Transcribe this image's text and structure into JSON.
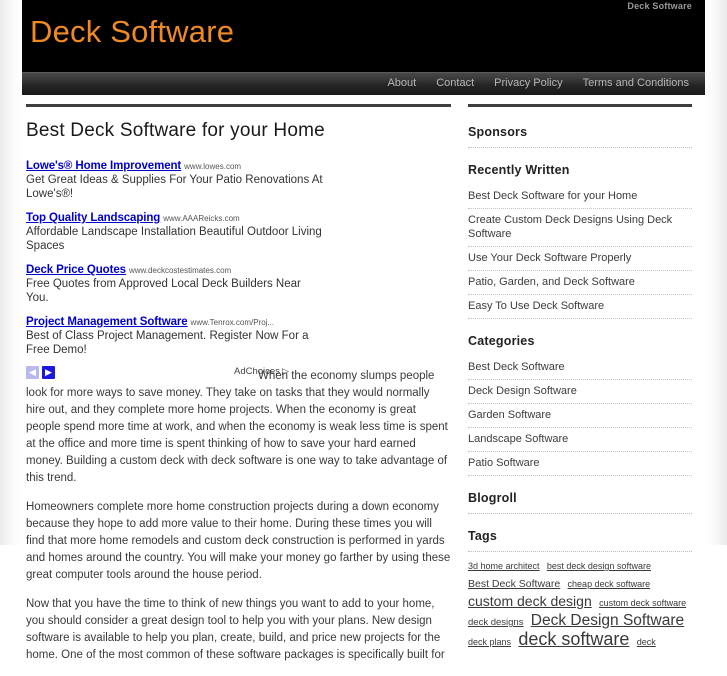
{
  "header": {
    "tagline": "Deck Software",
    "title": "Deck Software"
  },
  "nav": {
    "items": [
      {
        "label": "About"
      },
      {
        "label": "Contact"
      },
      {
        "label": "Privacy Policy"
      },
      {
        "label": "Terms and Conditions"
      }
    ]
  },
  "post": {
    "title": "Best Deck Software for your Home",
    "paragraphs": [
      "When the economy slumps people look for more ways to save money. They take on tasks that they would normally hire out, and they complete more home projects. When the economy is great people spend more time at work, and when the economy is weak less time is spent at the office and more time is spent thinking of how to save your hard earned money. Building a custom deck with deck software is one way to take advantage of this trend.",
      "Homeowners complete more home construction projects during a down economy because they hope to add more value to their home. During these times you will find that more home remodels and custom deck construction is performed in yards and homes around the country. You will make your money go farther by using these great computer tools around the house period.",
      "Now that you have the time to think of new things you want to add to your home, you should consider a great design tool to help you with your plans. New design software is available to help you plan, create, build, and price new projects for the home. One of the most common of these software packages is specifically built for"
    ]
  },
  "ads": {
    "units": [
      {
        "title": "Lowe's® Home Improvement",
        "url": "www.lowes.com",
        "desc": "Get Great Ideas & Supplies For Your Patio Renovations At Lowe's®!"
      },
      {
        "title": "Top Quality Landscaping",
        "url": "www.AAAReicks.com",
        "desc": "Affordable Landscape Installation Beautiful Outdoor Living Spaces"
      },
      {
        "title": "Deck Price Quotes",
        "url": "www.deckcostestimates.com",
        "desc": "Free Quotes from Approved Local Deck Builders Near You."
      },
      {
        "title": "Project Management Software",
        "url": "www.Tenrox.com/Proj...",
        "desc": "Best of Class Project Management. Register Now For a Free Demo!"
      }
    ],
    "prev_arrow": "◀",
    "next_arrow": "▶",
    "adchoices_label": "AdChoices",
    "adchoices_marker": "▷"
  },
  "sidebar": {
    "widgets": [
      {
        "title": "Sponsors",
        "items": []
      },
      {
        "title": "Recently Written",
        "items": [
          "Best Deck Software for your Home",
          "Create Custom Deck Designs Using Deck Software",
          "Use Your Deck Software Properly",
          "Patio, Garden, and Deck Software",
          "Easy To Use Deck Software"
        ]
      },
      {
        "title": "Categories",
        "items": [
          "Best Deck Software",
          "Deck Design Software",
          "Garden Software",
          "Landscape Software",
          "Patio Software"
        ]
      },
      {
        "title": "Blogroll",
        "items": []
      }
    ],
    "tags_title": "Tags",
    "tags": [
      {
        "label": "3d home architect",
        "size": 9
      },
      {
        "label": "best deck design software",
        "size": 9
      },
      {
        "label": "Best Deck Software",
        "size": 10.5
      },
      {
        "label": "cheap deck software",
        "size": 9
      },
      {
        "label": "custom deck design",
        "size": 14
      },
      {
        "label": "custom deck software",
        "size": 9
      },
      {
        "label": "deck designs",
        "size": 9.5
      },
      {
        "label": "Deck Design Software",
        "size": 15.5
      },
      {
        "label": "deck plans",
        "size": 9
      },
      {
        "label": "deck software",
        "size": 18
      },
      {
        "label": "deck",
        "size": 9
      }
    ]
  },
  "colors": {
    "brand_orange": "#f08a24",
    "header_black": "#000000",
    "nav_grey": "#3b3b3b",
    "ad_link_blue": "#0000cc",
    "rule_dark": "#3f3f3f"
  }
}
